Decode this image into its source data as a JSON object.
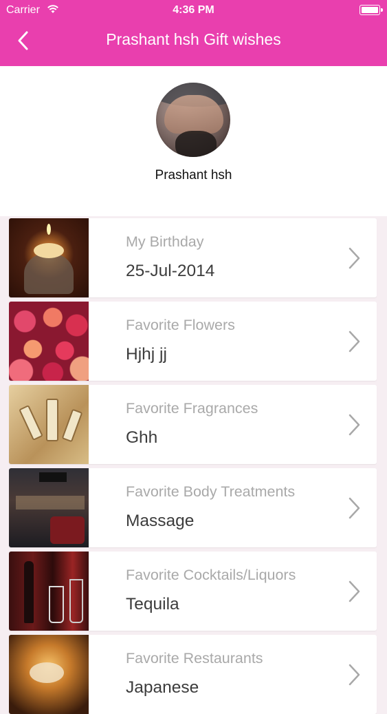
{
  "status_bar": {
    "carrier": "Carrier",
    "time": "4:36 PM"
  },
  "header": {
    "title": "Prashant hsh  Gift wishes",
    "background_color": "#e93fae"
  },
  "profile": {
    "name": "Prashant hsh"
  },
  "list": {
    "items": [
      {
        "label": "My Birthday",
        "value": "25-Jul-2014",
        "thumbnail": "birthday-cake-photo"
      },
      {
        "label": "Favorite Flowers",
        "value": "Hjhj jj",
        "thumbnail": "roses-photo"
      },
      {
        "label": "Favorite Fragrances",
        "value": "Ghh",
        "thumbnail": "perfume-bottles-photo"
      },
      {
        "label": "Favorite Body Treatments",
        "value": "Massage",
        "thumbnail": "salon-photo"
      },
      {
        "label": "Favorite Cocktails/Liquors",
        "value": "Tequila",
        "thumbnail": "bar-photo"
      },
      {
        "label": "Favorite Restaurants",
        "value": "Japanese",
        "thumbnail": "restaurant-photo"
      }
    ]
  }
}
